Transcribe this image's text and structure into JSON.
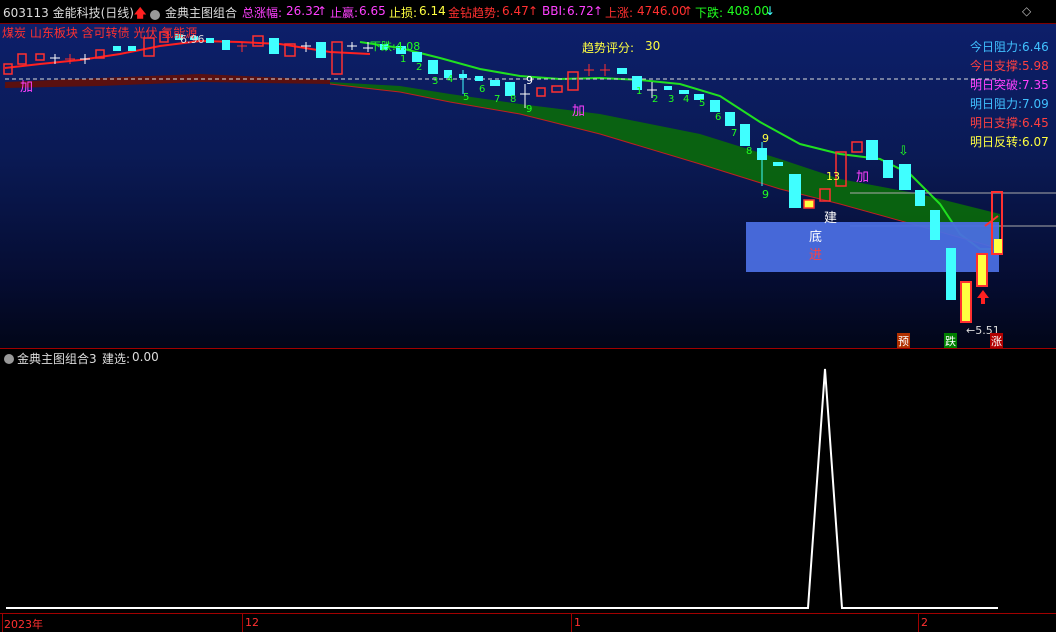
{
  "topbar": {
    "stock": "603113 金能科技(日线)",
    "indicator": "金典主图组合",
    "zong_label": "总涨幅:",
    "zong_val": "26.32",
    "zhiying_label": "止赢:",
    "zhiying_val": "6.65",
    "zhisun_label": "止损:",
    "zhisun_val": "6.14",
    "jinzuan_label": "金钻趋势:",
    "jinzuan_val": "6.47",
    "bbi_label": "BBI:",
    "bbi_val": "6.72",
    "shangzhang_label": "上涨:",
    "shangzhang_val": "4746.00",
    "xiadie_label": "下跌:",
    "xiadie_val": "408.00"
  },
  "colors": {
    "red": "#ff3030",
    "magenta": "#ff40ff",
    "yellow": "#ffff40",
    "cyan": "#40ffff",
    "green": "#20ff20",
    "white": "#ffffff"
  },
  "main": {
    "concepts": "煤炭 山东板块 含可转债 光伏 氢能源",
    "trend_score_label": "趋势评分:",
    "trend_score": "30",
    "xiadie_marker": "下跌:4.08",
    "low_marker": "←5.51",
    "high_marker": "6.96",
    "right_panel": [
      {
        "label": "今日阻力:",
        "value": "6.46",
        "color": "#40c0ff"
      },
      {
        "label": "今日支撑:",
        "value": "5.98",
        "color": "#ff4040"
      },
      {
        "label": "明日突破:",
        "value": "7.35",
        "color": "#ff40ff"
      },
      {
        "label": "明日阻力:",
        "value": "7.09",
        "color": "#40c0ff"
      },
      {
        "label": "明日支撑:",
        "value": "6.45",
        "color": "#ff4040"
      },
      {
        "label": "明日反转:",
        "value": "6.07",
        "color": "#ffff40"
      }
    ],
    "jia_labels": [
      "加",
      "加",
      "加"
    ],
    "jian_label": "建",
    "di_label": "底",
    "jin_label": "进",
    "yu_label": "预",
    "die_label": "跌",
    "zhang_label": "涨",
    "count_13": "13",
    "count_9a": "9",
    "count_9b": "9",
    "count_9c": "9",
    "count_digits": [
      "1",
      "2",
      "3",
      "4",
      "5",
      "6",
      "7",
      "8",
      "9",
      "1",
      "2",
      "3",
      "4",
      "5",
      "6",
      "7",
      "8",
      "9"
    ]
  },
  "sub": {
    "title": "金典主图组合3",
    "jianxuan_label": "建选:",
    "jianxuan_val": "0.00"
  },
  "xaxis": {
    "labels": [
      "2023年",
      "12",
      "1",
      "2"
    ]
  },
  "icons": {
    "topbar_menu": "menu-circle-icon",
    "topbar_up": "red-up-arrow-icon",
    "topbar_diamond": "diamond-icon"
  }
}
